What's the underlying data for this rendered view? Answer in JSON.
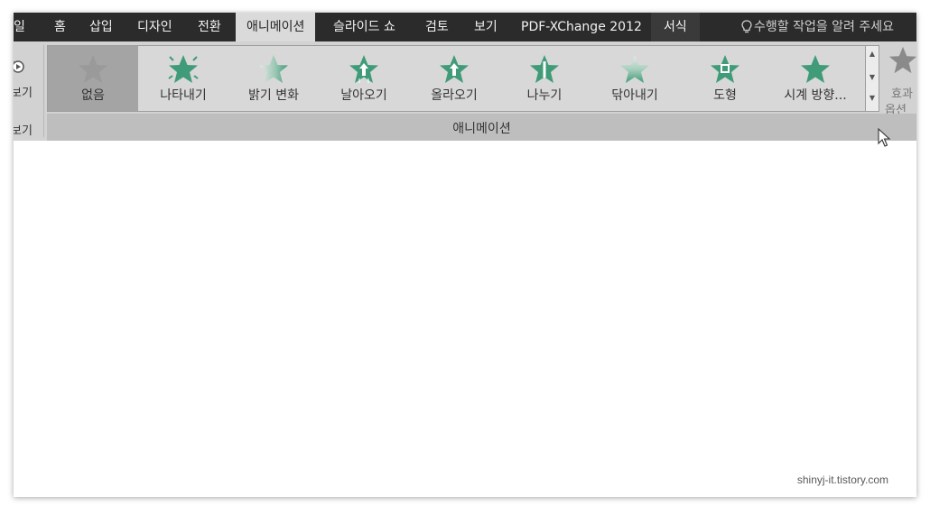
{
  "tabs": [
    "일",
    "홈",
    "삽입",
    "디자인",
    "전환",
    "애니메이션",
    "슬라이드 쇼",
    "검토",
    "보기",
    "PDF-XChange 2012",
    "서식"
  ],
  "active_tab": "애니메이션",
  "tell_me": "수행할 작업을 알려 주세요",
  "preview": {
    "label": "보기",
    "group_label": "보기"
  },
  "gallery": [
    {
      "label": "없음",
      "selected": true
    },
    {
      "label": "나타내기"
    },
    {
      "label": "밝기 변화"
    },
    {
      "label": "날아오기"
    },
    {
      "label": "올라오기"
    },
    {
      "label": "나누기"
    },
    {
      "label": "닦아내기"
    },
    {
      "label": "도형"
    },
    {
      "label": "시계 방향..."
    }
  ],
  "effect_options": {
    "line1": "효과",
    "line2": "옵션"
  },
  "group_label": "애니메이션",
  "watermark": "shinyj-it.tistory.com",
  "colors": {
    "star_green": "#3f9b78",
    "tabbar_bg": "#2b2b2b",
    "ribbon_bg": "#d2d2d2"
  }
}
